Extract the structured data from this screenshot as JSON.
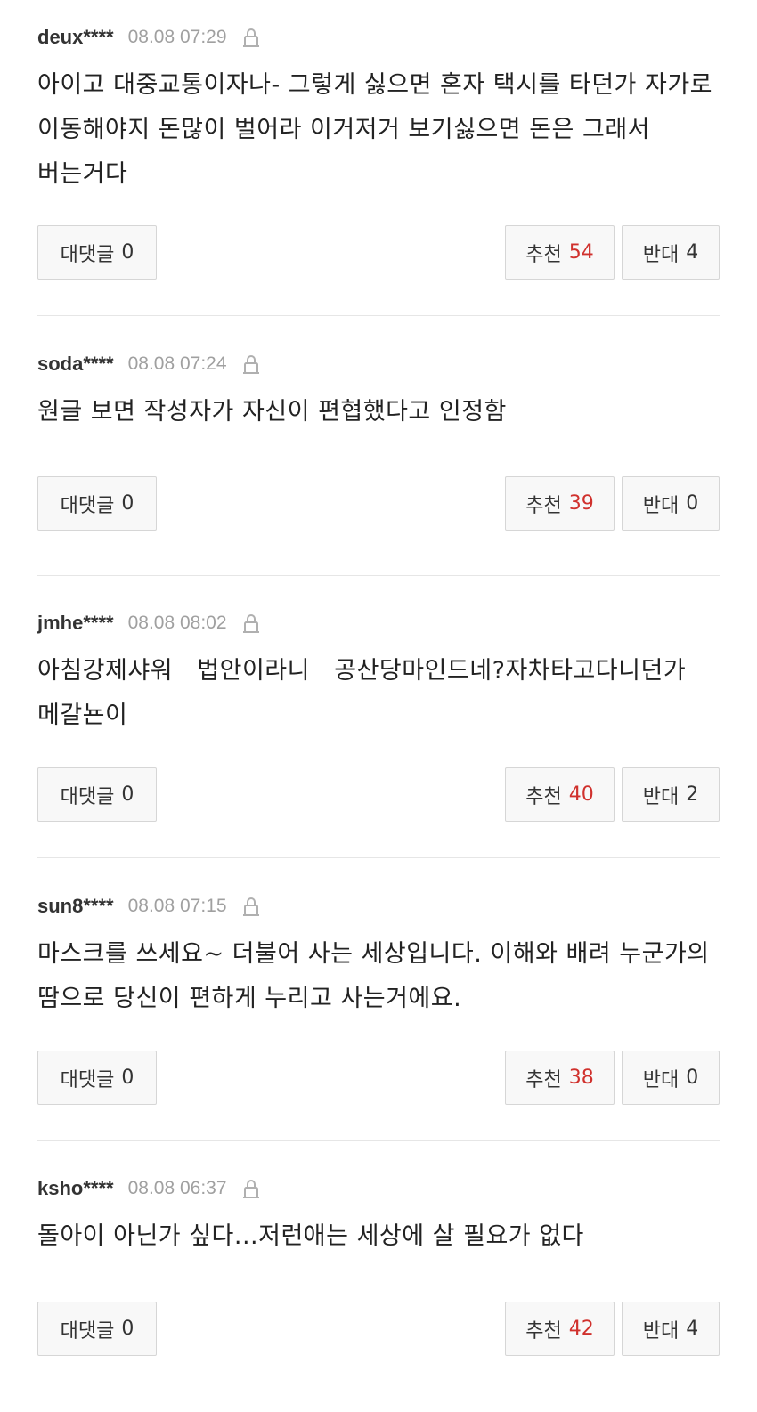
{
  "lock_icon_color": "#b0b0b0",
  "like_count_color": "#d0312d",
  "comments": [
    {
      "user": "deux****",
      "time": "08.08 07:29",
      "text": "아이고 대중교통이자나- 그렇게 싫으면 혼자 택시를 타던가 자가로 이동해야지 돈많이 벌어라 이거저거 보기싫으면 돈은 그래서 버는거다",
      "reply_label": "대댓글",
      "reply_count": "0",
      "like_label": "추천",
      "like_count": "54",
      "dislike_label": "반대",
      "dislike_count": "4"
    },
    {
      "user": "soda****",
      "time": "08.08 07:24",
      "text": "원글 보면 작성자가 자신이 편협했다고 인정함",
      "reply_label": "대댓글",
      "reply_count": "0",
      "like_label": "추천",
      "like_count": "39",
      "dislike_label": "반대",
      "dislike_count": "0"
    },
    {
      "user": "jmhe****",
      "time": "08.08 08:02",
      "text": "아침강제샤워   법안이라니   공산당마인드네?자차타고다니던가 메갈뇬이",
      "reply_label": "대댓글",
      "reply_count": "0",
      "like_label": "추천",
      "like_count": "40",
      "dislike_label": "반대",
      "dislike_count": "2"
    },
    {
      "user": "sun8****",
      "time": "08.08 07:15",
      "text": "마스크를 쓰세요~ 더불어 사는 세상입니다. 이해와 배려 누군가의 땀으로 당신이 편하게 누리고 사는거에요.",
      "reply_label": "대댓글",
      "reply_count": "0",
      "like_label": "추천",
      "like_count": "38",
      "dislike_label": "반대",
      "dislike_count": "0"
    },
    {
      "user": "ksho****",
      "time": "08.08 06:37",
      "text": "돌아이 아닌가 싶다...저런애는 세상에 살 필요가 없다",
      "reply_label": "대댓글",
      "reply_count": "0",
      "like_label": "추천",
      "like_count": "42",
      "dislike_label": "반대",
      "dislike_count": "4"
    }
  ]
}
